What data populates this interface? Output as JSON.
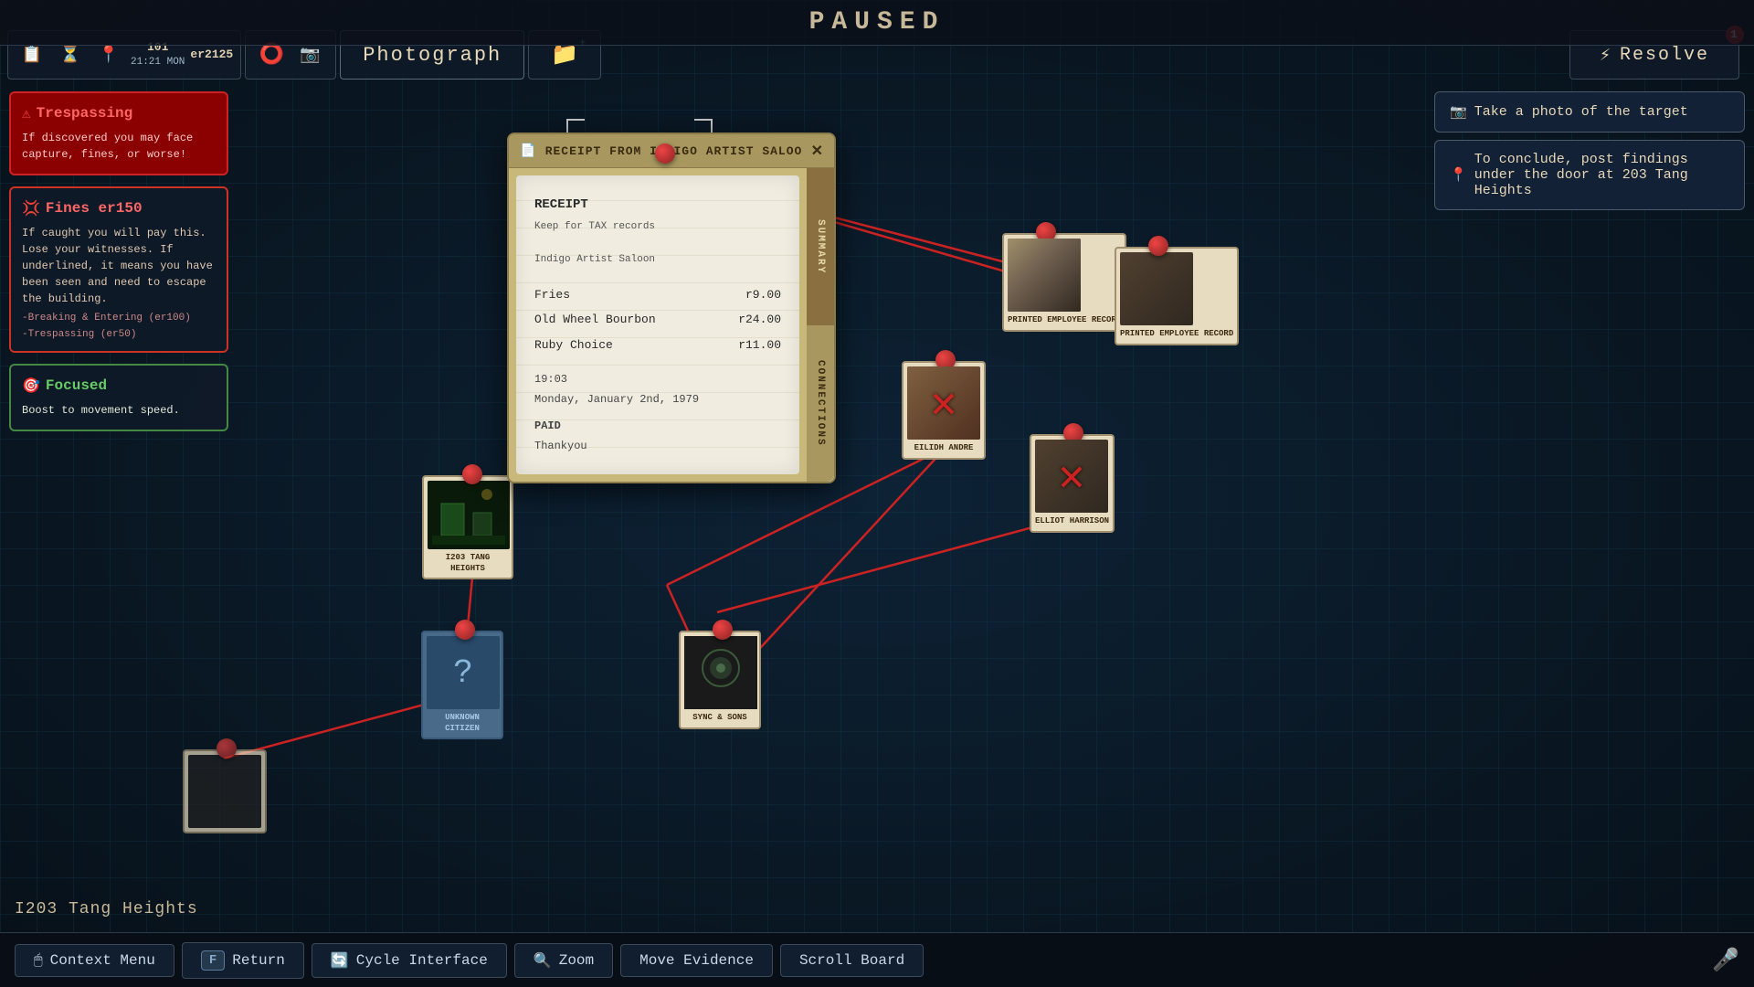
{
  "header": {
    "paused_label": "PAUSED"
  },
  "toolbar": {
    "photograph_label": "Photograph",
    "resolve_label": "Resolve",
    "notification_count": "1",
    "stat_101": "101",
    "stat_er2125": "er2125",
    "stat_time": "21:21 MON"
  },
  "alerts": {
    "trespassing": {
      "title": "Trespassing",
      "body": "If discovered you may face capture, fines, or worse!"
    },
    "fines": {
      "title": "Fines er150",
      "body": "If caught you will pay this. Lose your witnesses. If underlined, it means you have been seen and need to escape the building.",
      "sub1": "-Breaking & Entering (er100)",
      "sub2": "-Trespassing (er50)"
    },
    "focused": {
      "title": "Focused",
      "body": "Boost to movement speed."
    }
  },
  "hints": {
    "take_photo": "Take a photo of the target",
    "conclude": "To conclude, post findings under the door at 203 Tang Heights"
  },
  "receipt": {
    "title": "Receipt from Indigo Artist Saloo",
    "receipt_title": "RECEIPT",
    "keep_for": "Keep for TAX records",
    "saloon": "Indigo Artist Saloon",
    "items": [
      {
        "name": "Fries",
        "price": "r9.00"
      },
      {
        "name": "Old Wheel Bourbon",
        "price": "r24.00"
      },
      {
        "name": "Ruby Choice",
        "price": "r11.00"
      }
    ],
    "time": "19:03",
    "date": "Monday, January 2nd, 1979",
    "paid": "PAID",
    "thankyou": "Thankyou",
    "tab1": "SUMMARY",
    "tab2": "CONNECTIONS"
  },
  "evidence": {
    "printed_employee_1": {
      "label": "Printed Employee Record"
    },
    "printed_employee_2": {
      "label": "Printed Employee Record"
    },
    "eilidh": {
      "label": "Eilidh Andre"
    },
    "elliot": {
      "label": "Elliot Harrison"
    },
    "location": {
      "label": "I203 Tang Heights"
    },
    "unknown_citizen": {
      "label": "Unknown Citizen"
    },
    "sync_sons": {
      "label": "Sync & Sons"
    }
  },
  "bottom_toolbar": {
    "context_menu": "Context Menu",
    "return_label": "Return",
    "return_key": "F",
    "cycle_interface": "Cycle Interface",
    "zoom": "Zoom",
    "move_evidence": "Move Evidence",
    "scroll_board": "Scroll Board"
  },
  "location": {
    "name": "I203 Tang Heights"
  }
}
